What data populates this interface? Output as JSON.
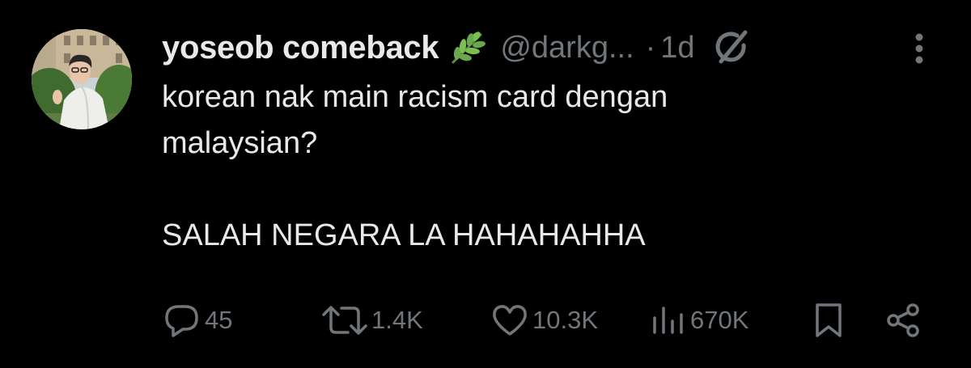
{
  "tweet": {
    "display_name": "yoseob comeback",
    "handle": "@darkg...",
    "separator": "·",
    "time": "1d",
    "body_lines": [
      "korean nak main racism card dengan",
      "malaysian?",
      "",
      "SALAH NEGARA LA HAHAHAHHA"
    ],
    "name_emoji_icon": "herb-leaf-icon",
    "menu_icon": "more-vertical-icon",
    "grok_icon": "grok-icon"
  },
  "actions": {
    "replies": "45",
    "reposts": "1.4K",
    "likes": "10.3K",
    "views": "670K",
    "icons": [
      "reply-icon",
      "repost-icon",
      "like-icon",
      "views-icon",
      "bookmark-icon",
      "share-icon"
    ]
  },
  "colors": {
    "background": "#000000",
    "primary_text": "#e7e9ea",
    "secondary_text": "#71767b",
    "leaf_green": "#6aa84f"
  }
}
